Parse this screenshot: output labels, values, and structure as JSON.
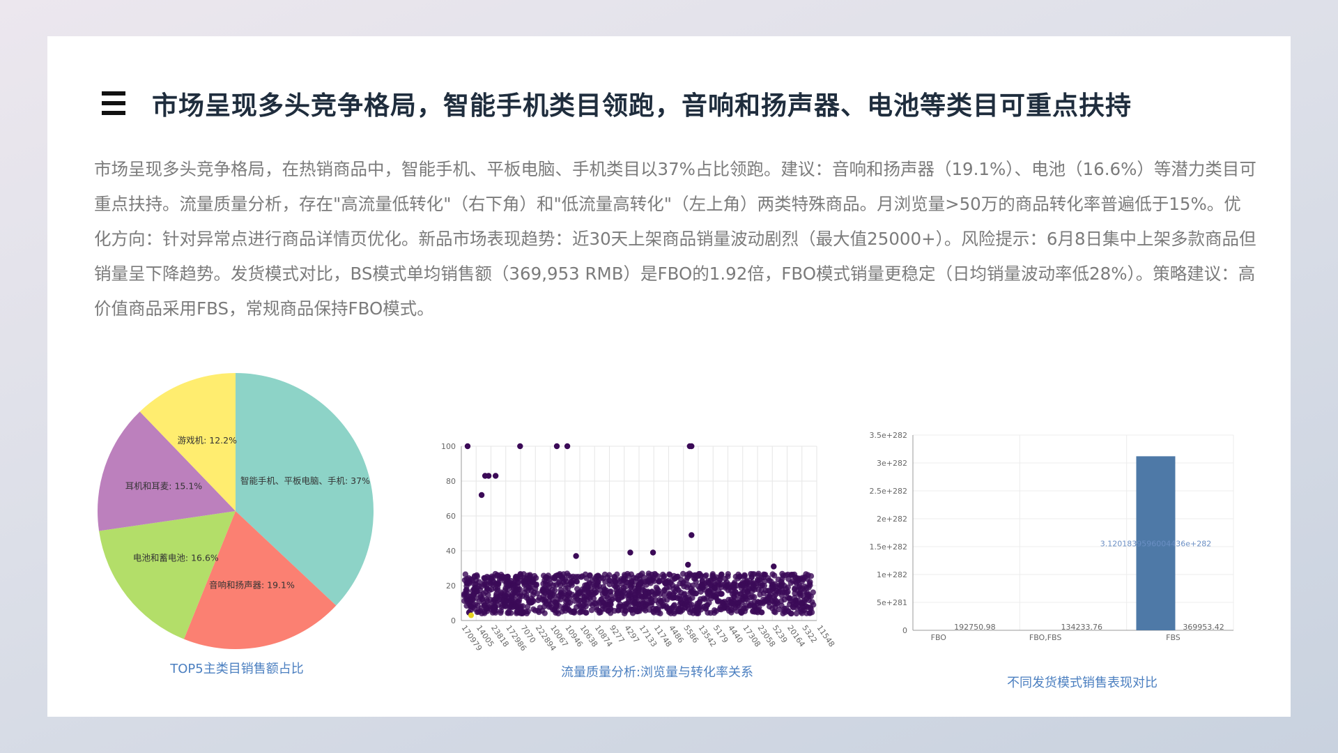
{
  "header": {
    "title": "市场呈现多头竞争格局，智能手机类目领跑，音响和扬声器、电池等类目可重点扶持"
  },
  "summary": "市场呈现多头竞争格局，在热销商品中，智能手机、平板电脑、手机类目以37%占比领跑。建议：音响和扬声器（19.1%）、电池（16.6%）等潜力类目可重点扶持。流量质量分析，存在\"高流量低转化\"（右下角）和\"低流量高转化\"（左上角）两类特殊商品。月浏览量>50万的商品转化率普遍低于15%。优化方向：针对异常点进行商品详情页优化。新品市场表现趋势：近30天上架商品销量波动剧烈（最大值25000+）。风险提示：6月8日集中上架多款商品但销量呈下降趋势。发货模式对比，BS模式单均销售额（369,953 RMB）是FBO的1.92倍，FBO模式销量更稳定（日均销量波动率低28%）。策略建议：高价值商品采用FBS，常规商品保持FBO模式。",
  "colors": {
    "pie": [
      "#8dd3c7",
      "#fb8072",
      "#b3de69",
      "#bc80bd",
      "#ffed6f"
    ],
    "scatter": "#3b0a57",
    "scatter_highlight": "#e5d21f",
    "bar": "#4e79a7",
    "caption": "#4b7fc0"
  },
  "chart_data": [
    {
      "type": "pie",
      "caption": "TOP5主类目销售额占比",
      "slices": [
        {
          "label": "智能手机、平板电脑、手机",
          "value": 37,
          "display": "智能手机、平板电脑、手机: 37%"
        },
        {
          "label": "音响和扬声器",
          "value": 19.1,
          "display": "音响和扬声器: 19.1%"
        },
        {
          "label": "电池和蓄电池",
          "value": 16.6,
          "display": "电池和蓄电池: 16.6%"
        },
        {
          "label": "耳机和耳麦",
          "value": 15.1,
          "display": "耳机和耳麦: 15.1%"
        },
        {
          "label": "游戏机",
          "value": 12.2,
          "display": "游戏机: 12.2%"
        }
      ]
    },
    {
      "type": "scatter",
      "caption": "流量质量分析:浏览量与转化率关系",
      "ylim": [
        0,
        100
      ],
      "yticks": [
        "0",
        "20",
        "40",
        "60",
        "80",
        "100"
      ],
      "xticks": [
        "170979",
        "14005",
        "23818",
        "172986",
        "7070",
        "222894",
        "10067",
        "10946",
        "10638",
        "10874",
        "9277",
        "4297",
        "17133",
        "11748",
        "4486",
        "5586",
        "13542",
        "5179",
        "4440",
        "17308",
        "23058",
        "5239",
        "20164",
        "5322",
        "11548"
      ],
      "outliers": [
        {
          "x": 2,
          "y": 100
        },
        {
          "x": 10,
          "y": 72
        },
        {
          "x": 12,
          "y": 83
        },
        {
          "x": 14,
          "y": 83
        },
        {
          "x": 18,
          "y": 83
        },
        {
          "x": 32,
          "y": 100
        },
        {
          "x": 53,
          "y": 100
        },
        {
          "x": 59,
          "y": 100
        },
        {
          "x": 64,
          "y": 37
        },
        {
          "x": 95,
          "y": 39
        },
        {
          "x": 108,
          "y": 39
        },
        {
          "x": 129,
          "y": 100
        },
        {
          "x": 130,
          "y": 100
        },
        {
          "x": 130,
          "y": 49
        },
        {
          "x": 128,
          "y": 32
        },
        {
          "x": 177,
          "y": 31
        }
      ],
      "cluster": {
        "y_min": 4,
        "y_max": 27,
        "count": 1400
      }
    },
    {
      "type": "bar",
      "caption": "不同发货模式销售表现对比",
      "categories": [
        "FBO",
        "FBO,FBS",
        "FBS"
      ],
      "values": [
        192750.98,
        134233.76,
        369953.42
      ],
      "value_labels": [
        "192750.98",
        "134233.76",
        "369953.42"
      ],
      "big_bar_value": 3.12e+282,
      "big_bar_label": "3.1201839596004436e+282",
      "yticks": [
        "0",
        "5e+281",
        "1e+282",
        "1.5e+282",
        "2e+282",
        "2.5e+282",
        "3e+282",
        "3.5e+282"
      ],
      "ylim": [
        0,
        3.5e+282
      ]
    }
  ]
}
